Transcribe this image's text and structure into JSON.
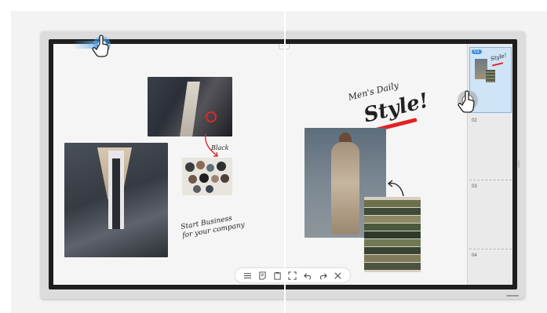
{
  "canvas": {
    "headline_small": "Men's Daily",
    "headline_large": "Style!",
    "note_black": "Black",
    "note_business_line1": "Start Business",
    "note_business_line2": "for your company"
  },
  "toolbar": {
    "items": [
      {
        "icon": "menu-icon",
        "glyph": "☰"
      },
      {
        "icon": "note-icon",
        "glyph": ""
      },
      {
        "icon": "paste-icon",
        "glyph": ""
      },
      {
        "icon": "fullscreen-icon",
        "glyph": ""
      },
      {
        "icon": "undo-icon",
        "glyph": ""
      },
      {
        "icon": "redo-icon",
        "glyph": ""
      },
      {
        "icon": "close-icon",
        "glyph": "✕"
      }
    ]
  },
  "pages": {
    "items": [
      {
        "label": "01",
        "active": true
      },
      {
        "label": "02",
        "active": false
      },
      {
        "label": "03",
        "active": false
      },
      {
        "label": "04",
        "active": false
      }
    ],
    "thumb_text": "Style!"
  },
  "colors": {
    "accent": "#3d8fdb",
    "highlight_red": "#e02424",
    "bezel": "#1e1e1e"
  }
}
